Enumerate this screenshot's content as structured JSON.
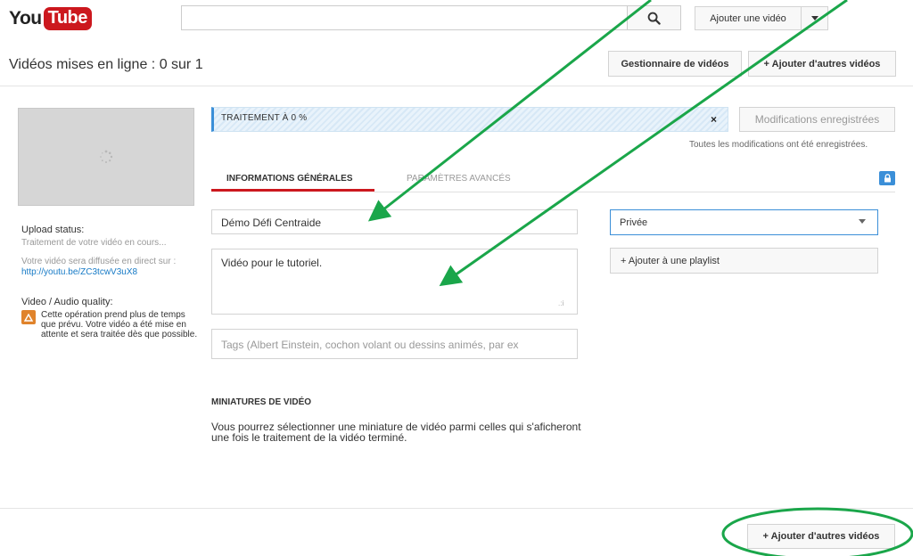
{
  "header": {
    "logo": {
      "you": "You",
      "tube": "Tube"
    },
    "search": {
      "value": "",
      "placeholder": ""
    },
    "upload_button": "Ajouter une vidéo",
    "icons": {
      "search": "search-icon",
      "caret": "caret-down-icon"
    }
  },
  "toolbar": {
    "page_title": "Vidéos mises en ligne : 0 sur 1",
    "video_manager": "Gestionnaire de vidéos",
    "add_more": "+ Ajouter d'autres vidéos"
  },
  "left_panel": {
    "upload_status_label": "Upload status:",
    "processing_text": "Traitement de votre vidéo en cours...",
    "live_text": "Votre vidéo sera diffusée en direct sur :",
    "video_link": "http://youtu.be/ZC3tcwV3uX8",
    "quality_label": "Video / Audio quality:",
    "quality_text": "Cette opération prend plus de temps que prévu. Votre vidéo a été mise en attente et sera traitée dès que possible.",
    "icons": {
      "spinner": "loading-spinner-icon",
      "warning": "warning-icon"
    }
  },
  "progress": {
    "label": "TRAITEMENT À 0 %",
    "value_percent": 0,
    "close": "×",
    "saved_button": "Modifications enregistrées",
    "saved_message": "Toutes les modifications ont été enregistrées."
  },
  "tabs": [
    {
      "label": "INFORMATIONS GÉNÉRALES",
      "active": true
    },
    {
      "label": "PARAMÈTRES AVANCÉS",
      "active": false
    }
  ],
  "form": {
    "title_value": "Démo Défi Centraide",
    "description_value": "Vidéo pour le tutoriel.",
    "tags_placeholder": "Tags (Albert Einstein, cochon volant ou dessins animés, par ex",
    "privacy_value": "Privée",
    "playlist_button": "+ Ajouter à une playlist",
    "icons": {
      "lock": "lock-icon",
      "resize": "resize-grip-icon"
    }
  },
  "thumbnails": {
    "title": "MINIATURES DE VIDÉO",
    "text_line1": "Vous pourrez sélectionner une miniature de vidéo parmi celles qui s'aficheront",
    "text_line2": "une fois le traitement de la vidéo terminé."
  },
  "footer": {
    "add_more": "+ Ajouter d'autres vidéos"
  },
  "colors": {
    "brand_red": "#cc181e",
    "accent_blue": "#3b8fd8",
    "annotation_green": "#1aa64a",
    "warning_orange": "#e0832b"
  }
}
